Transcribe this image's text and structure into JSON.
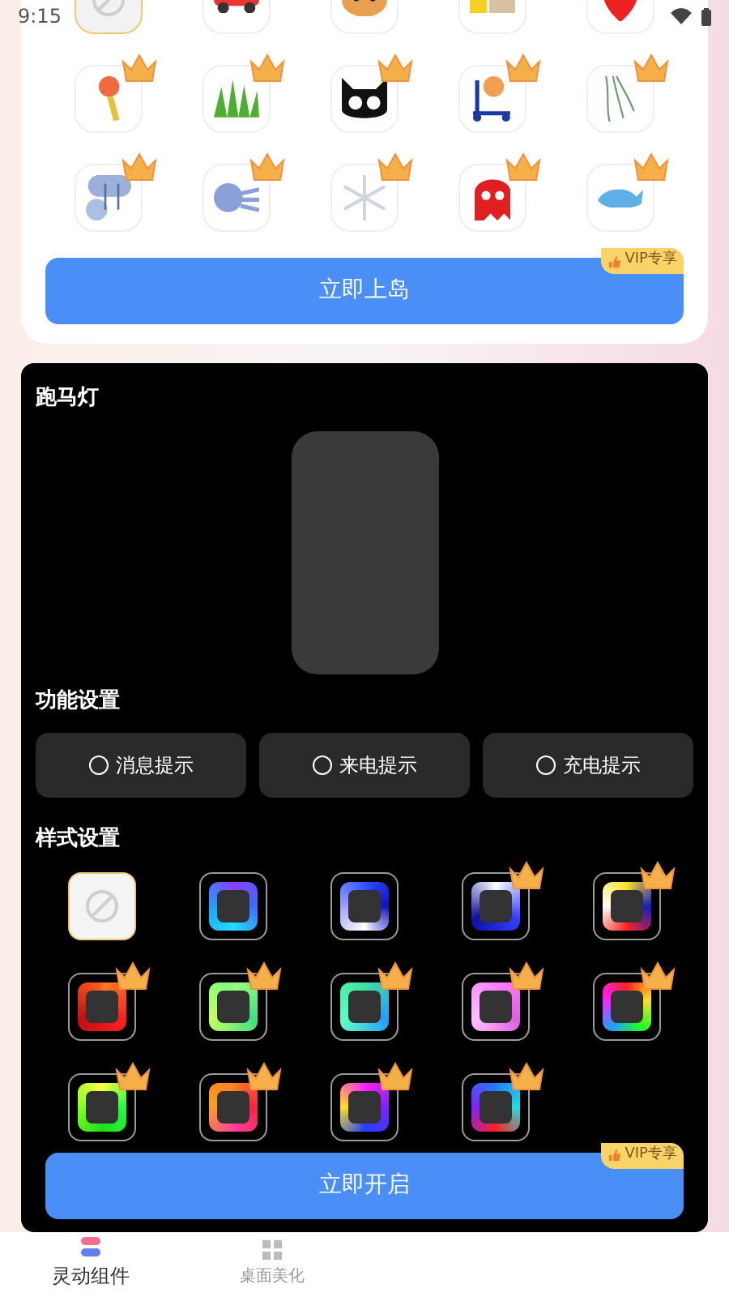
{
  "status_bar": {
    "time": "9:15"
  },
  "island": {
    "stickers": [
      {
        "kind": "none",
        "selected": true,
        "vip": false
      },
      {
        "kind": "sticker",
        "selected": false,
        "vip": false
      },
      {
        "kind": "sticker",
        "selected": false,
        "vip": false
      },
      {
        "kind": "sticker",
        "selected": false,
        "vip": false
      },
      {
        "kind": "sticker",
        "selected": false,
        "vip": false
      },
      {
        "kind": "sticker",
        "selected": false,
        "vip": true
      },
      {
        "kind": "sticker",
        "selected": false,
        "vip": true
      },
      {
        "kind": "sticker",
        "selected": false,
        "vip": true
      },
      {
        "kind": "sticker",
        "selected": false,
        "vip": true
      },
      {
        "kind": "sticker",
        "selected": false,
        "vip": true
      },
      {
        "kind": "sticker",
        "selected": false,
        "vip": true
      },
      {
        "kind": "sticker",
        "selected": false,
        "vip": true
      },
      {
        "kind": "sticker",
        "selected": false,
        "vip": true
      },
      {
        "kind": "sticker",
        "selected": false,
        "vip": true
      },
      {
        "kind": "sticker",
        "selected": false,
        "vip": true
      }
    ],
    "button": "立即上岛",
    "vip_badge": "VIP专享"
  },
  "marquee": {
    "title": "跑马灯",
    "function_title": "功能设置",
    "functions": [
      {
        "label": "消息提示",
        "checked": false
      },
      {
        "label": "来电提示",
        "checked": false
      },
      {
        "label": "充电提示",
        "checked": false
      }
    ],
    "style_title": "样式设置",
    "styles": [
      {
        "kind": "none",
        "selected": true,
        "vip": false
      },
      {
        "kind": "ring",
        "selected": false,
        "vip": false
      },
      {
        "kind": "ring",
        "selected": false,
        "vip": false
      },
      {
        "kind": "ring",
        "selected": false,
        "vip": true
      },
      {
        "kind": "ring",
        "selected": false,
        "vip": true
      },
      {
        "kind": "ring",
        "selected": false,
        "vip": true
      },
      {
        "kind": "ring",
        "selected": false,
        "vip": true
      },
      {
        "kind": "ring",
        "selected": false,
        "vip": true
      },
      {
        "kind": "ring",
        "selected": false,
        "vip": true
      },
      {
        "kind": "ring",
        "selected": false,
        "vip": true
      },
      {
        "kind": "ring",
        "selected": false,
        "vip": true
      },
      {
        "kind": "ring",
        "selected": false,
        "vip": true
      },
      {
        "kind": "ring",
        "selected": false,
        "vip": true
      },
      {
        "kind": "ring",
        "selected": false,
        "vip": true
      }
    ],
    "button": "立即开启",
    "vip_badge": "VIP专享"
  },
  "bottom_nav": [
    {
      "label": "灵动组件",
      "selected": true
    },
    {
      "label": "桌面美化",
      "selected": false
    }
  ]
}
